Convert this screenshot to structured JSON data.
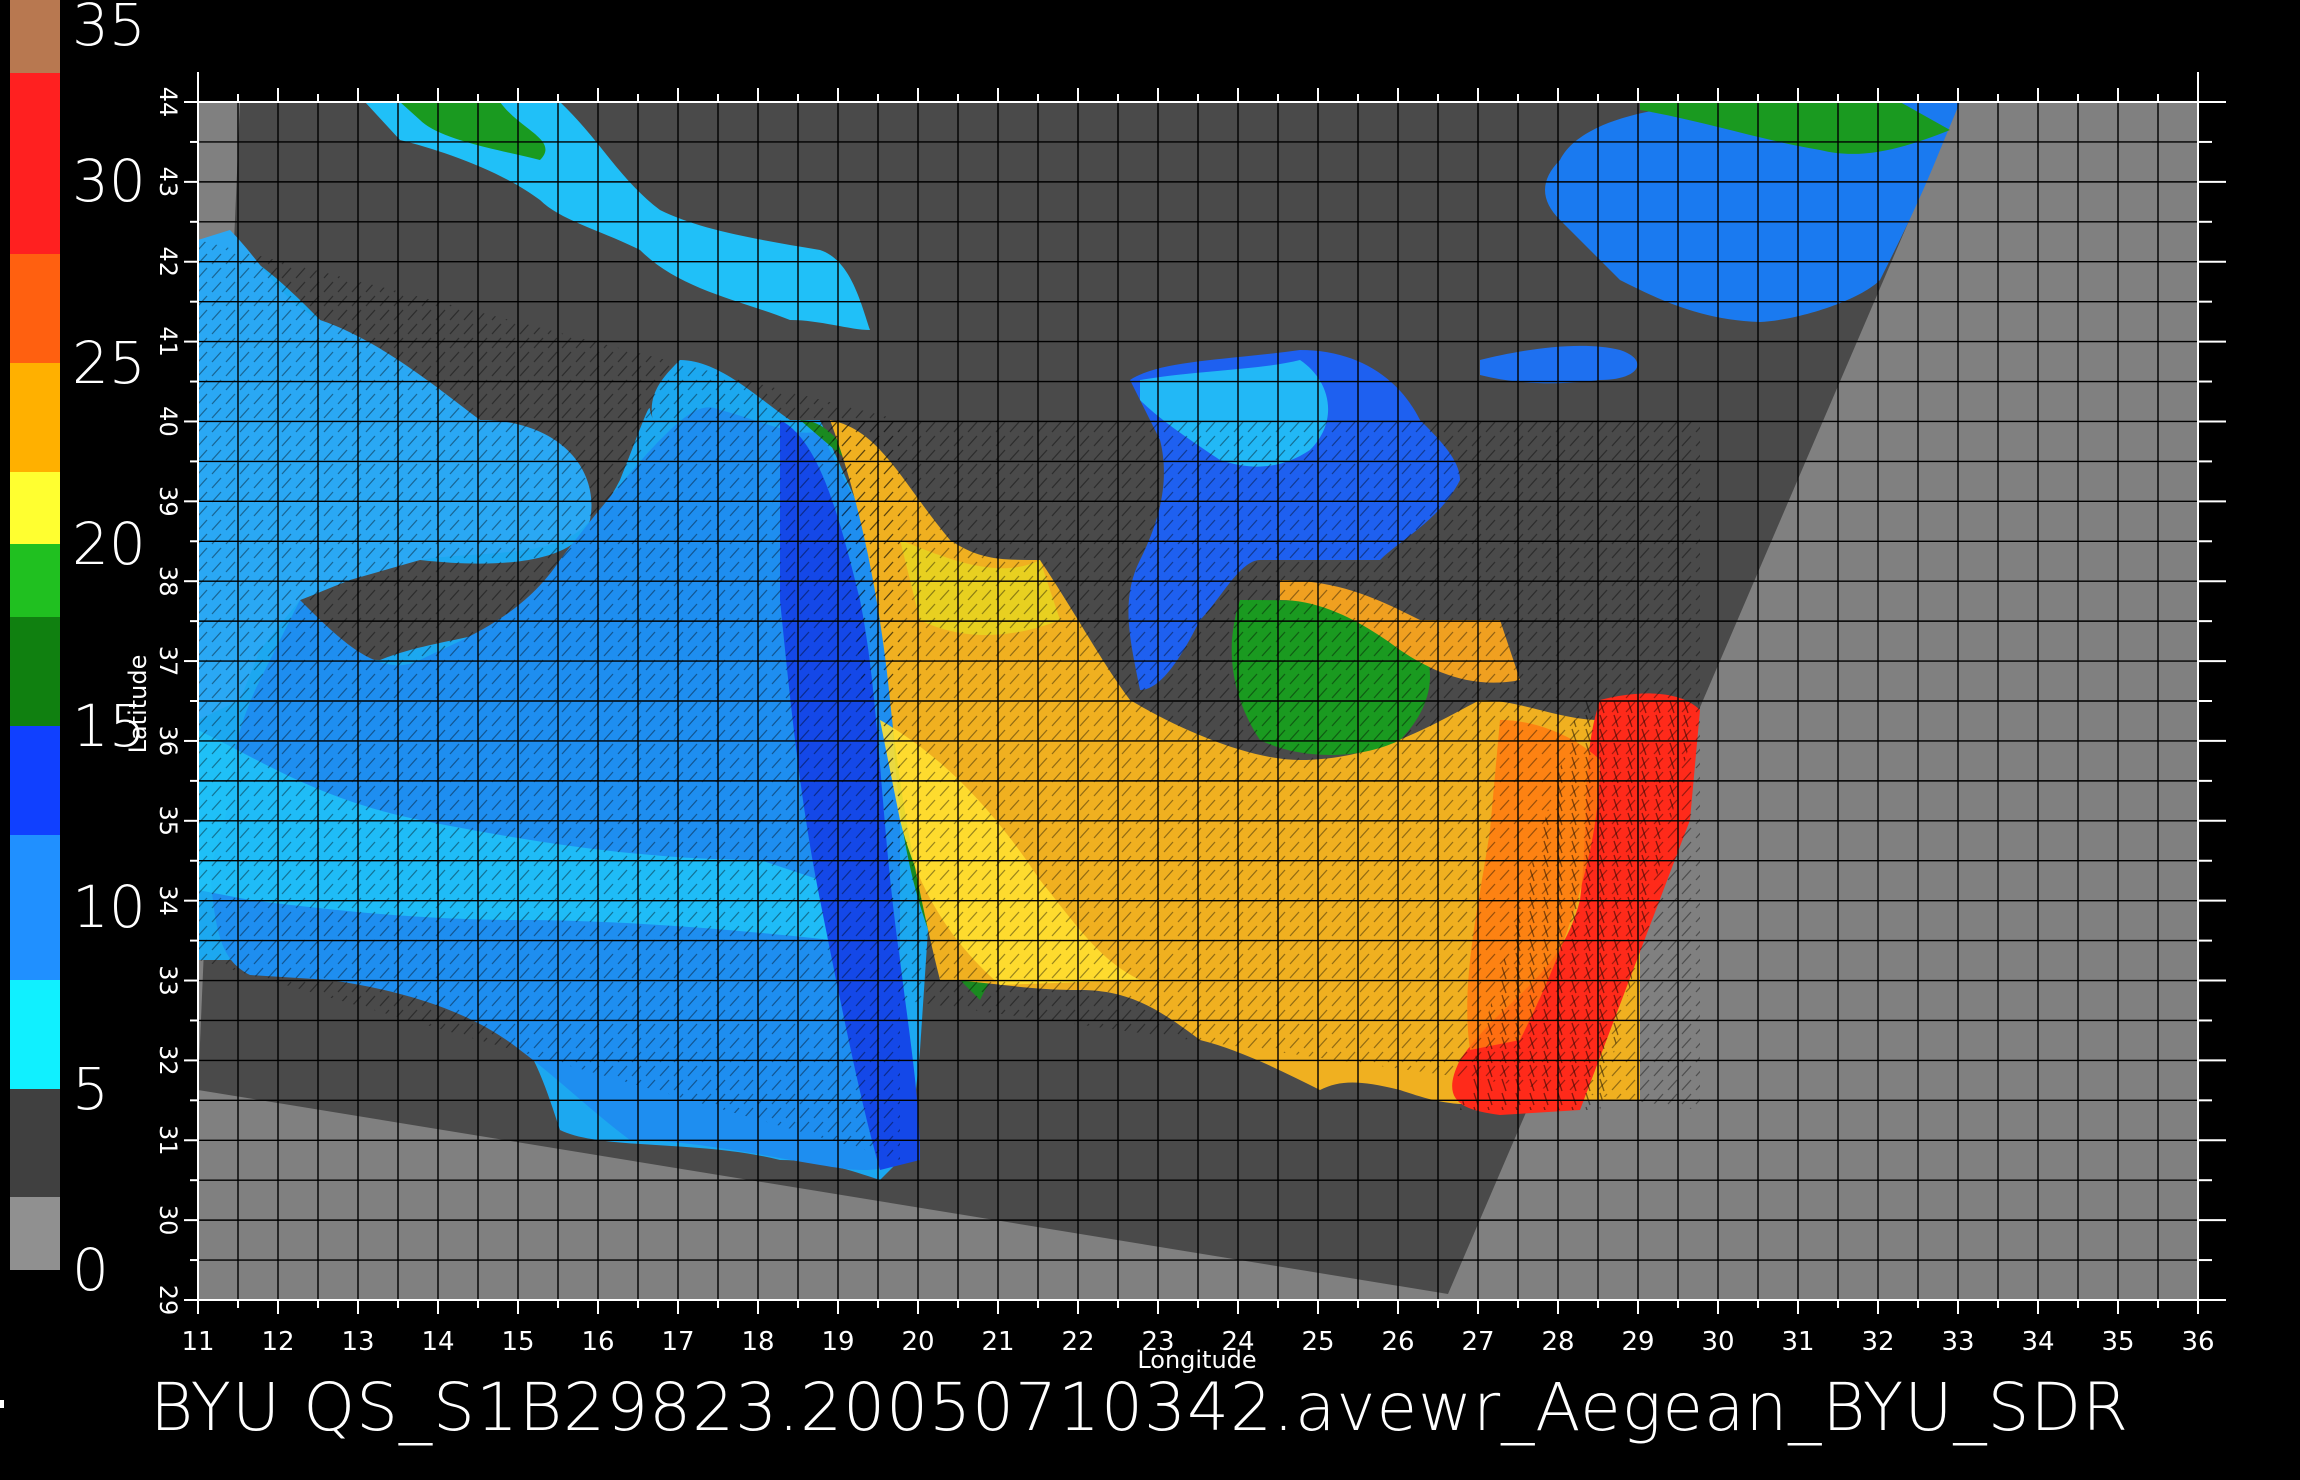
{
  "colorbar": {
    "labels": [
      "35",
      "30",
      "25",
      "20",
      "15",
      "10",
      "5",
      "0"
    ],
    "segments": [
      {
        "from": 35,
        "to": 33,
        "color": "#b87850"
      },
      {
        "from": 33,
        "to": 28,
        "color": "#ff2020"
      },
      {
        "from": 28,
        "to": 25,
        "color": "#ff6010"
      },
      {
        "from": 25,
        "to": 22,
        "color": "#ffb000"
      },
      {
        "from": 22,
        "to": 20,
        "color": "#ffff30"
      },
      {
        "from": 20,
        "to": 18,
        "color": "#20c020"
      },
      {
        "from": 18,
        "to": 15,
        "color": "#108010"
      },
      {
        "from": 15,
        "to": 12,
        "color": "#1040ff"
      },
      {
        "from": 12,
        "to": 8,
        "color": "#2090ff"
      },
      {
        "from": 8,
        "to": 5,
        "color": "#10f0ff"
      },
      {
        "from": 5,
        "to": 2,
        "color": "#404040"
      },
      {
        "from": 2,
        "to": 0,
        "color": "#909090"
      }
    ]
  },
  "axes": {
    "xlabel": "Longitude",
    "ylabel": "Latitude",
    "x_ticks": [
      "11",
      "12",
      "13",
      "14",
      "15",
      "16",
      "17",
      "18",
      "19",
      "20",
      "21",
      "22",
      "23",
      "24",
      "25",
      "26",
      "27",
      "28",
      "29",
      "30",
      "31",
      "32",
      "33",
      "34",
      "35",
      "36"
    ],
    "y_ticks": [
      "29",
      "30",
      "31",
      "32",
      "33",
      "34",
      "35",
      "36",
      "37",
      "38",
      "39",
      "40",
      "41",
      "42",
      "43",
      "44"
    ],
    "x_range": [
      11,
      36
    ],
    "y_range": [
      29,
      44
    ],
    "grid": true
  },
  "colors": {
    "land": "#4a4a4a",
    "no_data": "#808080",
    "background": "#000000",
    "grid": "#000000"
  },
  "caption": "BYU  QS_S1B29823.20050710342.avewr_Aegean_BYU_SDR"
}
